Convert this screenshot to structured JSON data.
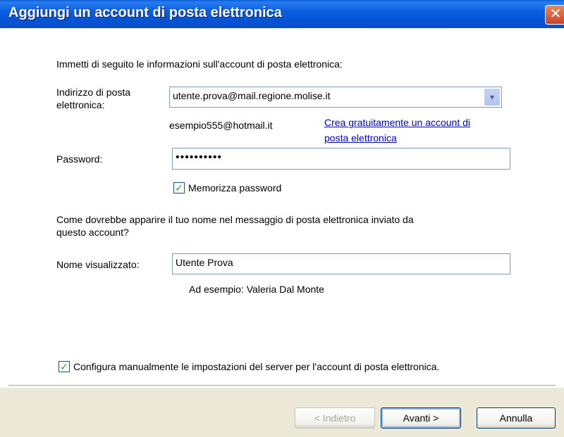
{
  "window": {
    "title": "Aggiungi un account di posta elettronica",
    "close_glyph": "✕"
  },
  "form": {
    "intro": "Immetti di seguito le informazioni sull'account di posta elettronica:",
    "email_label_line1": "Indirizzo di posta",
    "email_label_line2": "elettronica:",
    "email_value": "utente.prova@mail.regione.molise.it",
    "email_example": "esempio555@hotmail.it",
    "create_link_line1": "Crea gratuitamente un account di",
    "create_link_line2": "posta elettronica",
    "password_label": "Password:",
    "password_value": "••••••••••",
    "remember_label": "Memorizza password",
    "remember_checked": true,
    "name_question_line1": "Come dovrebbe apparire il tuo nome nel messaggio di posta elettronica inviato da",
    "name_question_line2": "questo account?",
    "display_name_label": "Nome visualizzato:",
    "display_name_value": "Utente Prova",
    "display_name_example": "Ad esempio: Valeria Dal Monte",
    "manual_config_label": "Configura manualmente le impostazioni del server per l'account di posta elettronica.",
    "manual_config_checked": true
  },
  "buttons": {
    "back": "< Indietro",
    "next": "Avanti >",
    "cancel": "Annulla"
  },
  "icons": {
    "check": "✓",
    "dropdown": "▾"
  }
}
